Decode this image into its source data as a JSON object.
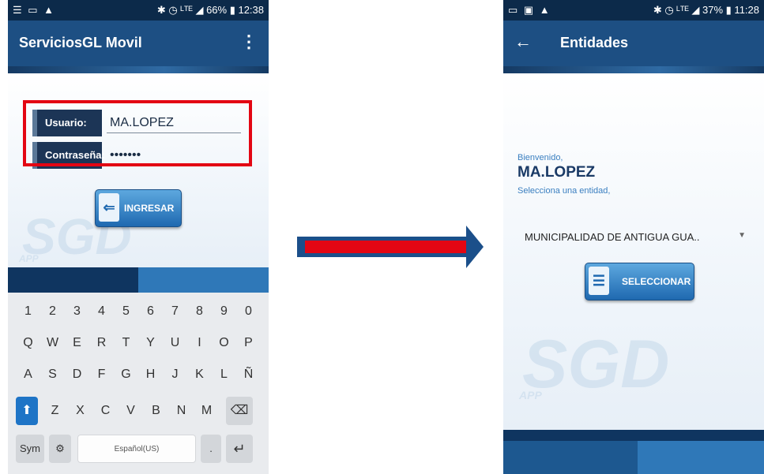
{
  "login_screen": {
    "status_left": "☰ ▭ ▲",
    "status_right": "✱ ◷ ᴸᵀᴱ ◢ 66% ▮ 12:38",
    "app_title": "ServiciosGL Movil",
    "menu_icon": "⋮",
    "user_label": "Usuario:",
    "user_value": "MA.LOPEZ",
    "password_label": "Contraseña:",
    "password_value": "•••••••",
    "login_button": "INGRESAR",
    "watermark": "SGD",
    "watermark_sub": "APP",
    "keyboard": {
      "row1": [
        "1",
        "2",
        "3",
        "4",
        "5",
        "6",
        "7",
        "8",
        "9",
        "0"
      ],
      "row2": [
        "Q",
        "W",
        "E",
        "R",
        "T",
        "Y",
        "U",
        "I",
        "O",
        "P"
      ],
      "row3": [
        "A",
        "S",
        "D",
        "F",
        "G",
        "H",
        "J",
        "K",
        "L",
        "Ñ"
      ],
      "row4": [
        "Z",
        "X",
        "C",
        "V",
        "B",
        "N",
        "M"
      ],
      "sym": "Sym",
      "space": "Español(US)",
      "period": ".",
      "shift_icon": "arrow-up-icon",
      "backspace_icon": "backspace-icon",
      "settings_icon": "gear-icon",
      "enter_icon": "enter-icon"
    }
  },
  "entities_screen": {
    "status_left": "▭ ▣ ▲",
    "status_right": "✱ ◷ ᴸᵀᴱ ◢ 37% ▮ 11:28",
    "back_icon": "←",
    "app_title": "Entidades",
    "welcome": "Bienvenido,",
    "user_name": "MA.LOPEZ",
    "prompt": "Selecciona una entidad,",
    "selected_entity": "MUNICIPALIDAD DE ANTIGUA GUA..",
    "select_button": "SELECCIONAR",
    "watermark": "SGD",
    "watermark_sub": "APP"
  },
  "colors": {
    "app_bar": "#1d4f83",
    "status_bar": "#0c2a4a",
    "highlight": "#e30613",
    "button": "#1f69b0"
  }
}
